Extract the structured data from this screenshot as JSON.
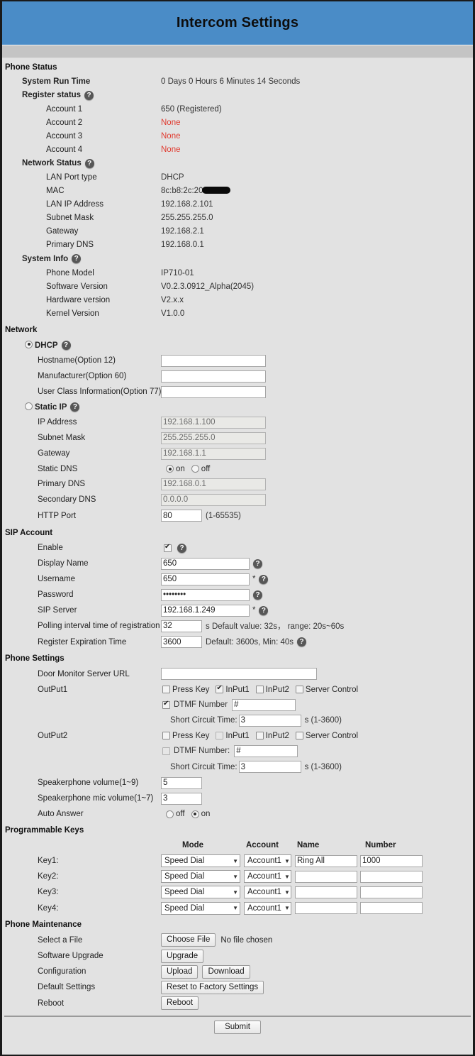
{
  "header": {
    "title": "Intercom Settings"
  },
  "sections": {
    "phone_status": {
      "title": "Phone Status",
      "system_run_time_label": "System Run Time",
      "system_run_time_value": "0 Days 0 Hours 6 Minutes 14 Seconds",
      "register_status_label": "Register status",
      "accounts": [
        {
          "label": "Account 1",
          "value": "650 (Registered)",
          "none": false
        },
        {
          "label": "Account 2",
          "value": "None",
          "none": true
        },
        {
          "label": "Account 3",
          "value": "None",
          "none": true
        },
        {
          "label": "Account 4",
          "value": "None",
          "none": true
        }
      ],
      "network_status_label": "Network Status",
      "network_rows": [
        {
          "label": "LAN Port type",
          "value": "DHCP"
        },
        {
          "label": "MAC",
          "value": "8c:b8:2c:20"
        },
        {
          "label": "LAN IP Address",
          "value": "192.168.2.101"
        },
        {
          "label": "Subnet Mask",
          "value": "255.255.255.0"
        },
        {
          "label": "Gateway",
          "value": "192.168.2.1"
        },
        {
          "label": "Primary DNS",
          "value": "192.168.0.1"
        }
      ],
      "system_info_label": "System Info",
      "system_rows": [
        {
          "label": "Phone Model",
          "value": "IP710-01"
        },
        {
          "label": "Software Version",
          "value": "V0.2.3.0912_Alpha(2045)"
        },
        {
          "label": "Hardware version",
          "value": "V2.x.x"
        },
        {
          "label": "Kernel Version",
          "value": "V1.0.0"
        }
      ]
    },
    "network": {
      "title": "Network",
      "dhcp_label": "DHCP",
      "dhcp_selected": true,
      "hostname_label": "Hostname(Option 12)",
      "hostname_value": "",
      "manufacturer_label": "Manufacturer(Option 60)",
      "manufacturer_value": "",
      "userclass_label": "User Class Information(Option 77)",
      "userclass_value": "",
      "static_ip_label": "Static IP",
      "static_selected": false,
      "ip_address_label": "IP Address",
      "ip_address_value": "192.168.1.100",
      "subnet_label": "Subnet Mask",
      "subnet_value": "255.255.255.0",
      "gateway_label": "Gateway",
      "gateway_value": "192.168.1.1",
      "static_dns_label": "Static DNS",
      "static_dns_on_label": "on",
      "static_dns_off_label": "off",
      "static_dns_value": "on",
      "primary_dns_label": "Primary DNS",
      "primary_dns_value": "192.168.0.1",
      "secondary_dns_label": "Secondary DNS",
      "secondary_dns_value": "0.0.0.0",
      "http_port_label": "HTTP Port",
      "http_port_value": "80",
      "http_port_range": "(1-65535)"
    },
    "sip_account": {
      "title": "SIP Account",
      "enable_label": "Enable",
      "enable_checked": true,
      "display_name_label": "Display Name",
      "display_name_value": "650",
      "username_label": "Username",
      "username_value": "650",
      "password_label": "Password",
      "password_value": "ssssssss",
      "sip_server_label": "SIP Server",
      "sip_server_value": "192.168.1.249",
      "polling_label": "Polling interval time of registration",
      "polling_value": "32",
      "polling_hint": "s Default value: 32s， range: 20s~60s",
      "register_exp_label": "Register Expiration Time",
      "register_exp_value": "3600",
      "register_exp_hint": "Default: 3600s, Min: 40s",
      "required_mark": "*"
    },
    "phone_settings": {
      "title": "Phone Settings",
      "door_monitor_label": "Door Monitor Server URL",
      "door_monitor_value": "",
      "output1_label": "OutPut1",
      "output2_label": "OutPut2",
      "opt_press_key": "Press Key",
      "opt_input1": "InPut1",
      "opt_input2": "InPut2",
      "opt_server_control": "Server Control",
      "output1": {
        "press_key": false,
        "input1": true,
        "input2": false,
        "server_control": false,
        "dtmf_label": "DTMF Number",
        "dtmf_checked": true,
        "dtmf_value": "#",
        "short_circuit_label": "Short Circuit Time:",
        "short_circuit_value": "3",
        "short_circuit_range": "s (1-3600)"
      },
      "output2": {
        "press_key": false,
        "input1": false,
        "input2": false,
        "server_control": false,
        "dtmf_label": "DTMF Number:",
        "dtmf_checked": false,
        "dtmf_value": "#",
        "short_circuit_label": "Short Circuit Time:",
        "short_circuit_value": "3",
        "short_circuit_range": "s (1-3600)"
      },
      "spk_volume_label": "Speakerphone volume(1~9)",
      "spk_volume_value": "5",
      "mic_volume_label": "Speakerphone mic volume(1~7)",
      "mic_volume_value": "3",
      "auto_answer_label": "Auto Answer",
      "auto_answer_off": "off",
      "auto_answer_on": "on",
      "auto_answer_value": "on"
    },
    "programmable_keys": {
      "title": "Programmable Keys",
      "columns": [
        "Mode",
        "Account",
        "Name",
        "Number"
      ],
      "rows": [
        {
          "key": "Key1:",
          "mode": "Speed Dial",
          "account": "Account1",
          "name": "Ring All",
          "number": "1000"
        },
        {
          "key": "Key2:",
          "mode": "Speed Dial",
          "account": "Account1",
          "name": "",
          "number": ""
        },
        {
          "key": "Key3:",
          "mode": "Speed Dial",
          "account": "Account1",
          "name": "",
          "number": ""
        },
        {
          "key": "Key4:",
          "mode": "Speed Dial",
          "account": "Account1",
          "name": "",
          "number": ""
        }
      ]
    },
    "phone_maintenance": {
      "title": "Phone Maintenance",
      "select_file_label": "Select a File",
      "choose_file_button": "Choose File",
      "no_file_chosen": "No file chosen",
      "software_upgrade_label": "Software Upgrade",
      "upgrade_button": "Upgrade",
      "configuration_label": "Configuration",
      "upload_button": "Upload",
      "download_button": "Download",
      "default_settings_label": "Default Settings",
      "reset_button": "Reset to Factory Settings",
      "reboot_label": "Reboot",
      "reboot_button": "Reboot"
    }
  },
  "footer": {
    "submit_label": "Submit"
  },
  "colors": {
    "header_blue": "#4a8cc7",
    "subbar_gray": "#c4c4c4",
    "page_bg": "#e2e2e2",
    "error_red": "#e03b30"
  },
  "icons": {
    "help": "?",
    "chevron_down": "▼"
  }
}
